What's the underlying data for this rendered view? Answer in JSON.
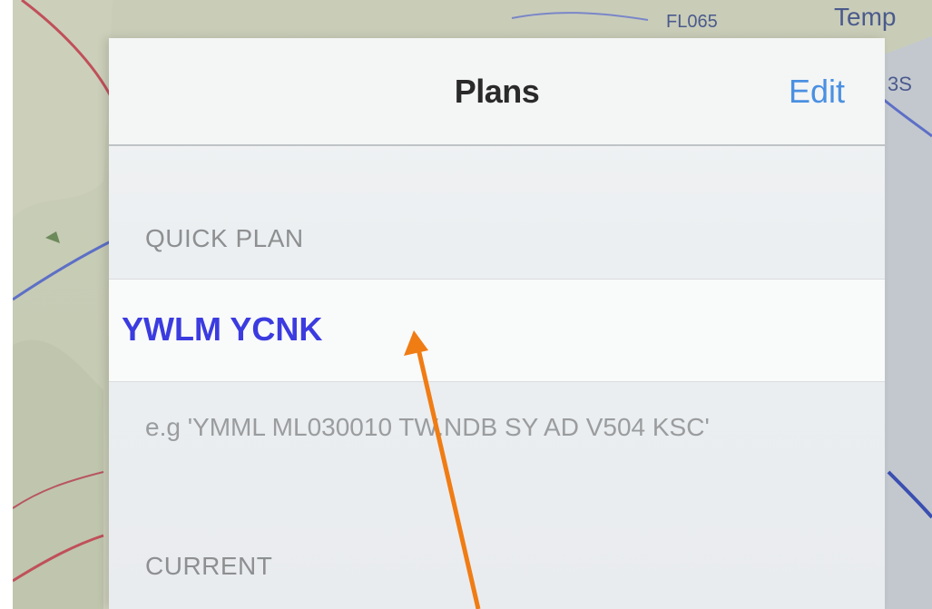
{
  "map": {
    "labels": [
      "FL065",
      "Temp",
      "3S"
    ]
  },
  "panel": {
    "title": "Plans",
    "edit_label": "Edit",
    "quick_plan_header": "QUICK PLAN",
    "plan_input_value": "YWLM YCNK",
    "hint": "e.g 'YMML ML030010 TW.NDB SY AD V504 KSC'",
    "current_header": "CURRENT"
  },
  "annotation": {
    "arrow_color": "#f07c14"
  }
}
